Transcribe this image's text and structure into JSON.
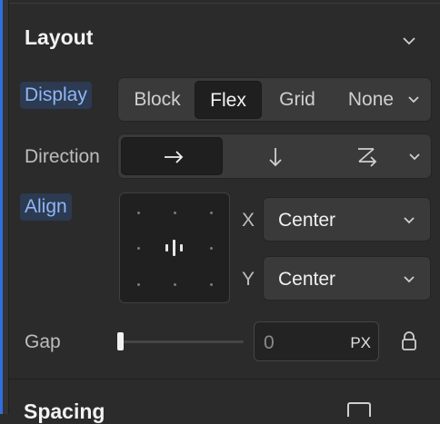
{
  "section": {
    "title": "Layout"
  },
  "display": {
    "label": "Display",
    "options": [
      "Block",
      "Flex",
      "Grid",
      "None"
    ],
    "selected": "Flex"
  },
  "direction": {
    "label": "Direction",
    "icons": [
      "arrow-right-icon",
      "arrow-down-icon",
      "wrap-icon",
      "chevron-down-icon"
    ]
  },
  "align": {
    "label": "Align",
    "x_label": "X",
    "y_label": "Y",
    "x_value": "Center",
    "y_value": "Center"
  },
  "gap": {
    "label": "Gap",
    "value": "0",
    "unit": "PX",
    "slider_level": 0
  },
  "next_section": {
    "title": "Spacing"
  }
}
